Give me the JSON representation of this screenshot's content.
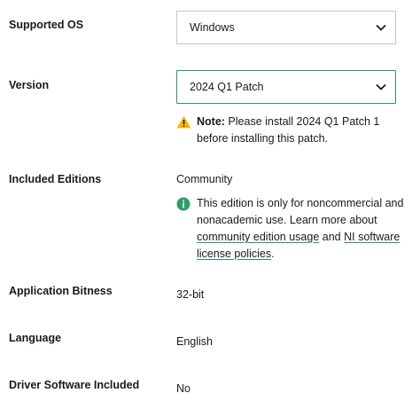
{
  "supported_os": {
    "label": "Supported OS",
    "selected": "Windows"
  },
  "version": {
    "label": "Version",
    "selected": "2024 Q1 Patch",
    "note_bold": "Note:",
    "note_text_1": " Please install 2024 Q1 Patch 1",
    "note_text_2": "before installing this patch."
  },
  "included_editions": {
    "label": "Included Editions",
    "value": "Community",
    "info_line_1": "This edition is only for noncommercial and",
    "info_line_2": "nonacademic use. Learn more about",
    "link_community": "community edition usage",
    "and_text": " and ",
    "link_ni_1": "NI software",
    "link_ni_2": "license policies",
    "period": "."
  },
  "bitness": {
    "label": "Application Bitness",
    "value": "32-bit"
  },
  "language": {
    "label": "Language",
    "value": "English"
  },
  "driver": {
    "label": "Driver Software Included",
    "value": "No"
  },
  "colors": {
    "accent": "#2e8f7c",
    "warning": "#f2b705",
    "info": "#2f9b6b"
  },
  "icons": {
    "dropdown": "chevron-down-icon",
    "warning": "warning-icon",
    "info": "info-icon"
  }
}
